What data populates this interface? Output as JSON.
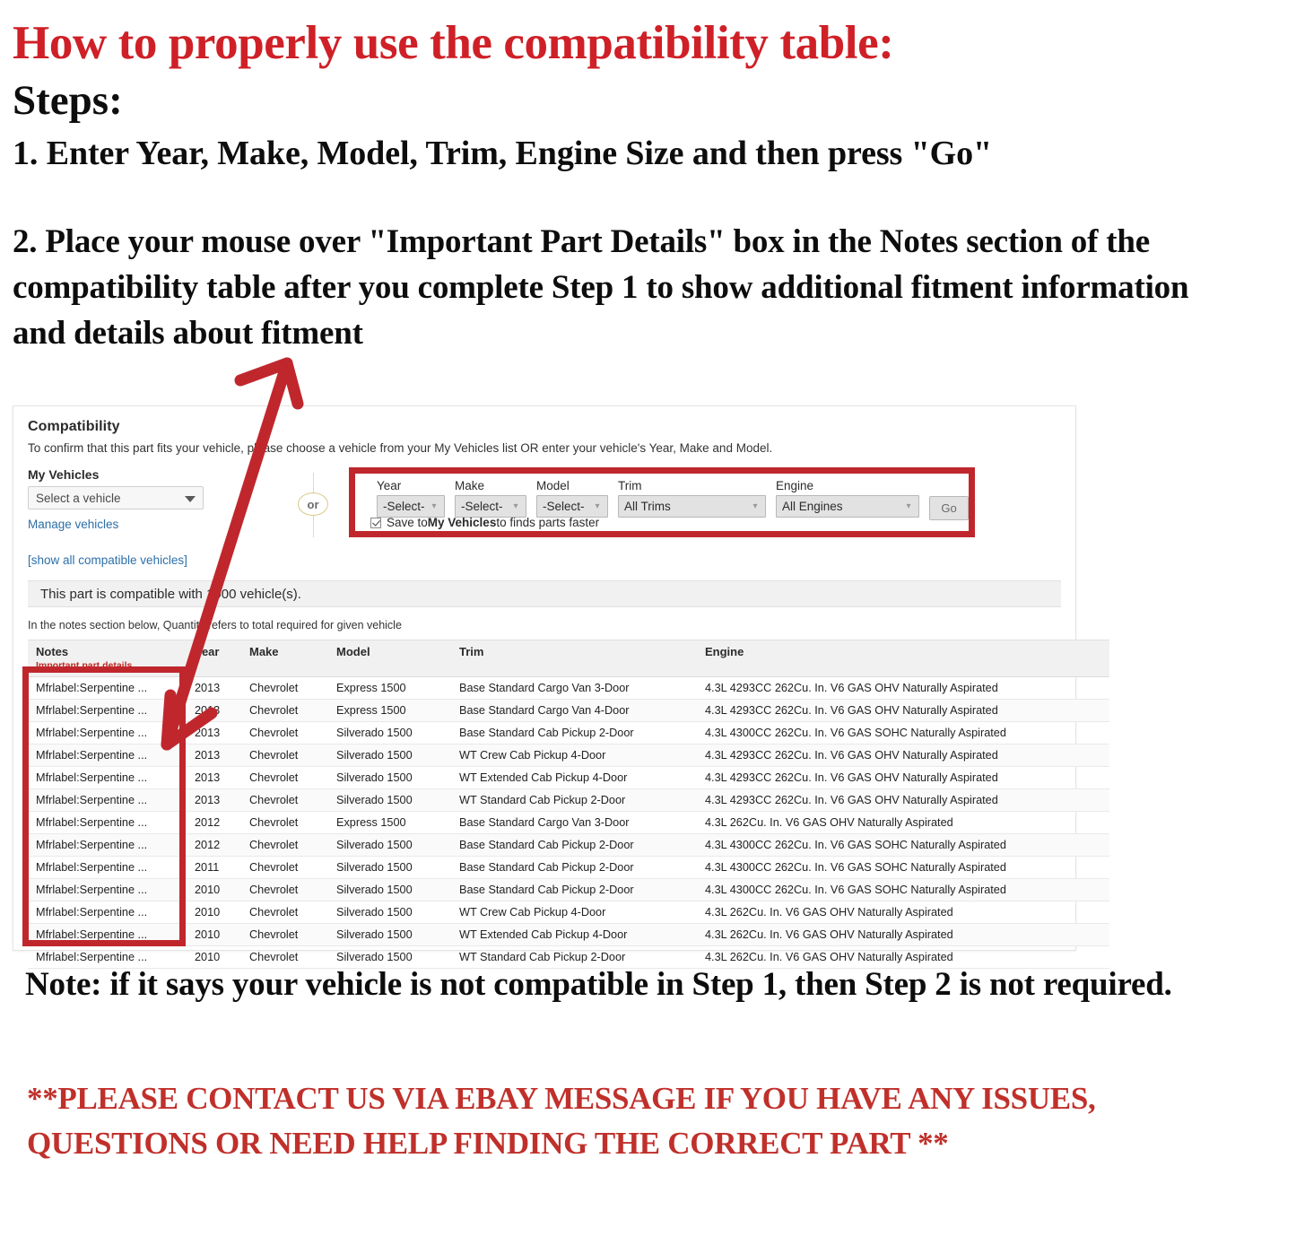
{
  "intro": {
    "headline": "How to properly use the compatibility table:",
    "steps_label": "Steps:",
    "step_one": "1. Enter Year, Make, Model, Trim, Engine Size and then press \"Go\"",
    "step_two": "2. Place your mouse over \"Important Part Details\" box in the Notes section of the compatibility table after you complete Step 1 to show additional fitment information and details about fitment"
  },
  "compat": {
    "title": "Compatibility",
    "subtitle": "To confirm that this part fits your vehicle, please choose a vehicle from your My Vehicles list OR enter your vehicle's Year, Make and Model.",
    "my_vehicles_label": "My Vehicles",
    "my_vehicles_value": "Select a vehicle",
    "manage_link": "Manage vehicles",
    "or_text": "or",
    "show_all_link": "[show all compatible vehicles]",
    "banner": "This part is compatible with 1000 vehicle(s).",
    "qty_note": "In the notes section below, Quantity refers to total required for given vehicle",
    "fields": {
      "year_label": "Year",
      "year_value": "-Select-",
      "make_label": "Make",
      "make_value": "-Select-",
      "model_label": "Model",
      "model_value": "-Select-",
      "trim_label": "Trim",
      "trim_value": "All Trims",
      "engine_label": "Engine",
      "engine_value": "All Engines",
      "go_label": "Go"
    },
    "save_checkbox": {
      "prefix": "Save to ",
      "bold": "My Vehicles",
      "suffix": " to finds parts faster"
    }
  },
  "table": {
    "headers": {
      "notes": "Notes",
      "notes_sub": "Important part details",
      "year": "Year",
      "make": "Make",
      "model": "Model",
      "trim": "Trim",
      "engine": "Engine"
    },
    "rows": [
      {
        "notes": "Mfrlabel:Serpentine ...",
        "year": "2013",
        "make": "Chevrolet",
        "model": "Express 1500",
        "trim": "Base Standard Cargo Van 3-Door",
        "engine": "4.3L 4293CC 262Cu. In. V6 GAS OHV Naturally Aspirated"
      },
      {
        "notes": "Mfrlabel:Serpentine ...",
        "year": "2013",
        "make": "Chevrolet",
        "model": "Express 1500",
        "trim": "Base Standard Cargo Van 4-Door",
        "engine": "4.3L 4293CC 262Cu. In. V6 GAS OHV Naturally Aspirated"
      },
      {
        "notes": "Mfrlabel:Serpentine ...",
        "year": "2013",
        "make": "Chevrolet",
        "model": "Silverado 1500",
        "trim": "Base Standard Cab Pickup 2-Door",
        "engine": "4.3L 4300CC 262Cu. In. V6 GAS SOHC Naturally Aspirated"
      },
      {
        "notes": "Mfrlabel:Serpentine ...",
        "year": "2013",
        "make": "Chevrolet",
        "model": "Silverado 1500",
        "trim": "WT Crew Cab Pickup 4-Door",
        "engine": "4.3L 4293CC 262Cu. In. V6 GAS OHV Naturally Aspirated"
      },
      {
        "notes": "Mfrlabel:Serpentine ...",
        "year": "2013",
        "make": "Chevrolet",
        "model": "Silverado 1500",
        "trim": "WT Extended Cab Pickup 4-Door",
        "engine": "4.3L 4293CC 262Cu. In. V6 GAS OHV Naturally Aspirated"
      },
      {
        "notes": "Mfrlabel:Serpentine ...",
        "year": "2013",
        "make": "Chevrolet",
        "model": "Silverado 1500",
        "trim": "WT Standard Cab Pickup 2-Door",
        "engine": "4.3L 4293CC 262Cu. In. V6 GAS OHV Naturally Aspirated"
      },
      {
        "notes": "Mfrlabel:Serpentine ...",
        "year": "2012",
        "make": "Chevrolet",
        "model": "Express 1500",
        "trim": "Base Standard Cargo Van 3-Door",
        "engine": "4.3L 262Cu. In. V6 GAS OHV Naturally Aspirated"
      },
      {
        "notes": "Mfrlabel:Serpentine ...",
        "year": "2012",
        "make": "Chevrolet",
        "model": "Silverado 1500",
        "trim": "Base Standard Cab Pickup 2-Door",
        "engine": "4.3L 4300CC 262Cu. In. V6 GAS SOHC Naturally Aspirated"
      },
      {
        "notes": "Mfrlabel:Serpentine ...",
        "year": "2011",
        "make": "Chevrolet",
        "model": "Silverado 1500",
        "trim": "Base Standard Cab Pickup 2-Door",
        "engine": "4.3L 4300CC 262Cu. In. V6 GAS SOHC Naturally Aspirated"
      },
      {
        "notes": "Mfrlabel:Serpentine ...",
        "year": "2010",
        "make": "Chevrolet",
        "model": "Silverado 1500",
        "trim": "Base Standard Cab Pickup 2-Door",
        "engine": "4.3L 4300CC 262Cu. In. V6 GAS SOHC Naturally Aspirated"
      },
      {
        "notes": "Mfrlabel:Serpentine ...",
        "year": "2010",
        "make": "Chevrolet",
        "model": "Silverado 1500",
        "trim": "WT Crew Cab Pickup 4-Door",
        "engine": "4.3L 262Cu. In. V6 GAS OHV Naturally Aspirated"
      },
      {
        "notes": "Mfrlabel:Serpentine ...",
        "year": "2010",
        "make": "Chevrolet",
        "model": "Silverado 1500",
        "trim": "WT Extended Cab Pickup 4-Door",
        "engine": "4.3L 262Cu. In. V6 GAS OHV Naturally Aspirated"
      },
      {
        "notes": "Mfrlabel:Serpentine ...",
        "year": "2010",
        "make": "Chevrolet",
        "model": "Silverado 1500",
        "trim": "WT Standard Cab Pickup 2-Door",
        "engine": "4.3L 262Cu. In. V6 GAS OHV Naturally Aspirated"
      }
    ]
  },
  "footer": {
    "note": "Note: if it says your vehicle is not compatible in Step 1, then Step 2 is not required.",
    "contact": "**PLEASE CONTACT US VIA EBAY MESSAGE IF YOU HAVE ANY ISSUES, QUESTIONS OR NEED HELP FINDING THE CORRECT PART **"
  },
  "colors": {
    "headline_red": "#cf2027",
    "annotation_red": "#c0272d",
    "link_blue": "#2d6fa8",
    "notes_red": "#bf2a24"
  }
}
